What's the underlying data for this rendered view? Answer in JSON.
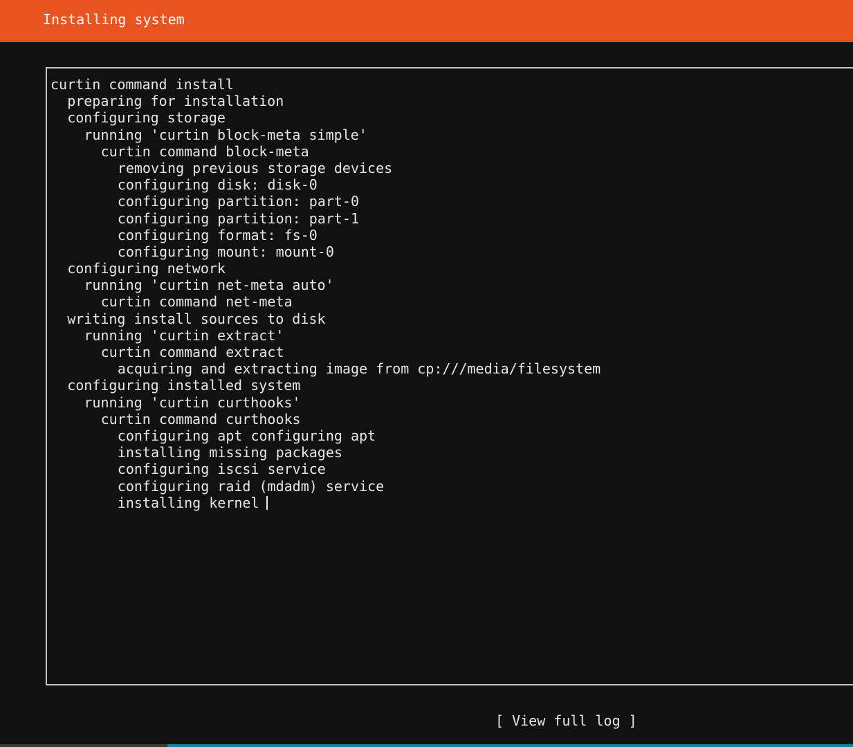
{
  "header": {
    "title": "Installing system"
  },
  "log": {
    "lines": [
      {
        "indent": 0,
        "text": "curtin command install"
      },
      {
        "indent": 1,
        "text": "preparing for installation"
      },
      {
        "indent": 1,
        "text": "configuring storage"
      },
      {
        "indent": 2,
        "text": "running 'curtin block-meta simple'"
      },
      {
        "indent": 3,
        "text": "curtin command block-meta"
      },
      {
        "indent": 4,
        "text": "removing previous storage devices"
      },
      {
        "indent": 4,
        "text": "configuring disk: disk-0"
      },
      {
        "indent": 4,
        "text": "configuring partition: part-0"
      },
      {
        "indent": 4,
        "text": "configuring partition: part-1"
      },
      {
        "indent": 4,
        "text": "configuring format: fs-0"
      },
      {
        "indent": 4,
        "text": "configuring mount: mount-0"
      },
      {
        "indent": 1,
        "text": "configuring network"
      },
      {
        "indent": 2,
        "text": "running 'curtin net-meta auto'"
      },
      {
        "indent": 3,
        "text": "curtin command net-meta"
      },
      {
        "indent": 1,
        "text": "writing install sources to disk"
      },
      {
        "indent": 2,
        "text": "running 'curtin extract'"
      },
      {
        "indent": 3,
        "text": "curtin command extract"
      },
      {
        "indent": 4,
        "text": "acquiring and extracting image from cp:///media/filesystem"
      },
      {
        "indent": 1,
        "text": "configuring installed system"
      },
      {
        "indent": 2,
        "text": "running 'curtin curthooks'"
      },
      {
        "indent": 3,
        "text": "curtin command curthooks"
      },
      {
        "indent": 4,
        "text": "configuring apt configuring apt"
      },
      {
        "indent": 4,
        "text": "installing missing packages"
      },
      {
        "indent": 4,
        "text": "configuring iscsi service"
      },
      {
        "indent": 4,
        "text": "configuring raid (mdadm) service"
      },
      {
        "indent": 4,
        "text": "installing kernel",
        "active": true
      }
    ]
  },
  "footer": {
    "view_log_label": "[ View full log ]"
  }
}
